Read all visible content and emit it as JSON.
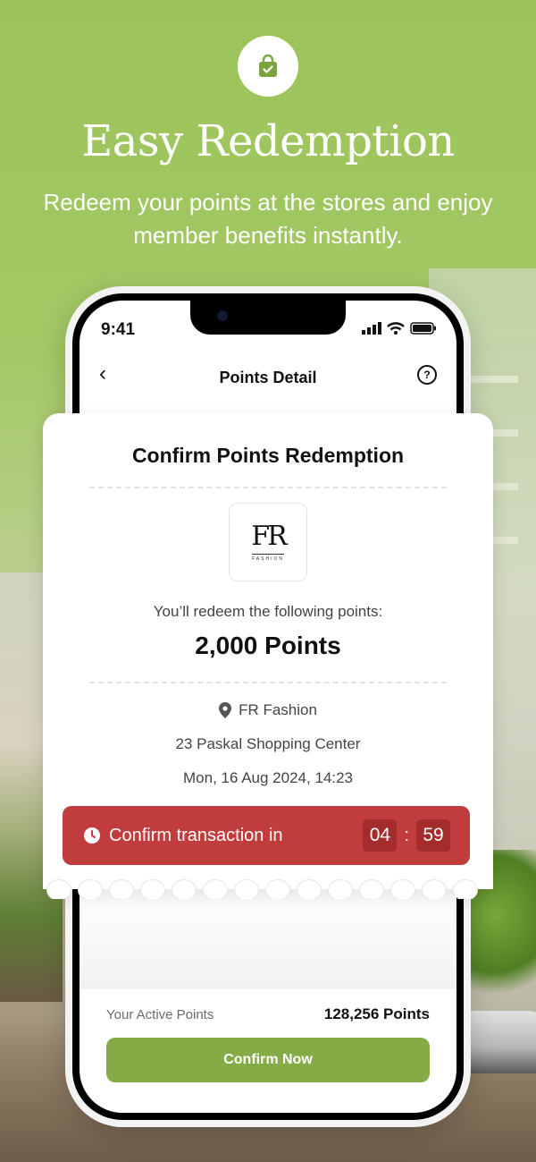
{
  "header": {
    "title": "Easy Redemption",
    "subtitle": "Redeem your points at the stores and enjoy member benefits instantly.",
    "icon": "shopping-bag-check-icon"
  },
  "status_bar": {
    "time": "9:41"
  },
  "nav": {
    "title": "Points Detail"
  },
  "card": {
    "title": "Confirm Points Redemption",
    "merchant_logo_text": "FR",
    "merchant_logo_sub": "FASHION",
    "redeem_label": "You’ll redeem the following points:",
    "points": "2,000 Points",
    "merchant_name": "FR Fashion",
    "address": "23 Paskal Shopping Center",
    "datetime": "Mon, 16 Aug 2024, 14:23",
    "timer_label": "Confirm transaction in",
    "timer_minutes": "04",
    "timer_seconds": "59"
  },
  "footer": {
    "active_points_label": "Your Active Points",
    "active_points_value": "128,256 Points",
    "confirm_button": "Confirm Now"
  },
  "colors": {
    "brand_green": "#86ab46",
    "timer_red": "#c13c3c",
    "background_green": "#9cc35a"
  }
}
